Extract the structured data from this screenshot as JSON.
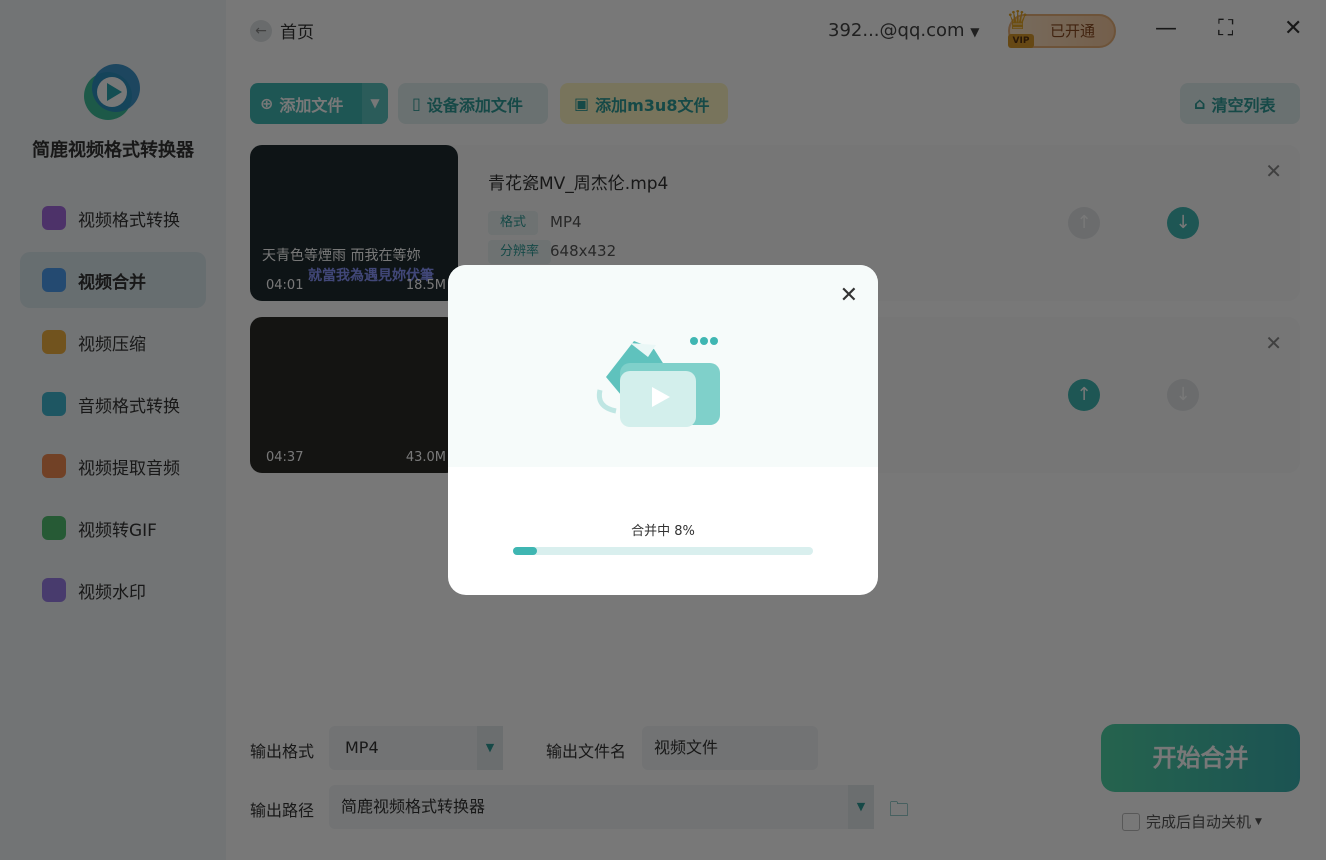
{
  "app": {
    "name": "简鹿视频格式转换器"
  },
  "sidebar": {
    "items": [
      {
        "label": "视频格式转换",
        "color": "#a36be0",
        "active": false
      },
      {
        "label": "视频合并",
        "color": "#4d9df0",
        "active": true
      },
      {
        "label": "视频压缩",
        "color": "#f0b040",
        "active": false
      },
      {
        "label": "音频格式转换",
        "color": "#40b6d0",
        "active": false
      },
      {
        "label": "视频提取音频",
        "color": "#f08a50",
        "active": false
      },
      {
        "label": "视频转GIF",
        "color": "#50c070",
        "active": false
      },
      {
        "label": "视频水印",
        "color": "#9a7ee8",
        "active": false
      }
    ]
  },
  "header": {
    "back_label": "首页",
    "user": "392...@qq.com",
    "vip_label": "已开通",
    "vip_badge": "VIP"
  },
  "toolbar": {
    "add_file": "添加文件",
    "device_add": "设备添加文件",
    "add_m3u8": "添加m3u8文件",
    "clear_list": "清空列表"
  },
  "files": [
    {
      "name": "青花瓷MV_周杰伦.mp4",
      "format_label": "格式",
      "format": "MP4",
      "resolution_label": "分辨率",
      "resolution": "648x432",
      "duration": "04:01",
      "size": "18.5M",
      "subtitle1": "天青色等煙雨 而我在等妳",
      "subtitle2": "就當我為遇見妳伏筆"
    },
    {
      "duration": "04:37",
      "size": "43.0M"
    }
  ],
  "output": {
    "format_label": "输出格式",
    "format": "MP4",
    "filename_label": "输出文件名",
    "filename": "视频文件",
    "path_label": "输出路径",
    "path": "简鹿视频格式转换器"
  },
  "actions": {
    "start": "开始合并",
    "shutdown": "完成后自动关机"
  },
  "modal": {
    "status": "合并中 8%",
    "progress": 0.08
  }
}
